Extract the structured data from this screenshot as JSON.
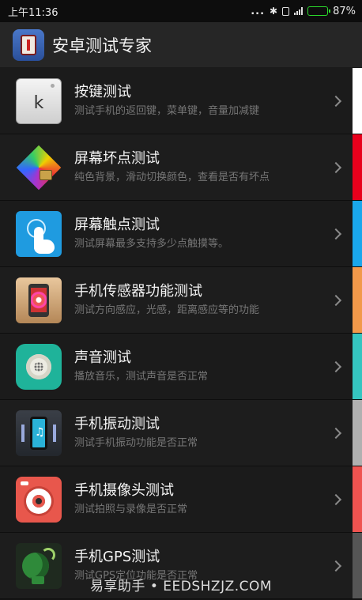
{
  "statusbar": {
    "time": "上午11:36",
    "dots": "...",
    "battery": "87%",
    "battery_level": 0.87
  },
  "header": {
    "title": "安卓测试专家"
  },
  "items": [
    {
      "title": "按键测试",
      "desc": "测试手机的返回键，菜单键，音量加减键",
      "icon": "keyboard-key-icon",
      "icon_letter": "k",
      "stripe": "#ffffff"
    },
    {
      "title": "屏幕坏点测试",
      "desc": "纯色背景，滑动切换颜色，查看是否有坏点",
      "icon": "dead-pixel-icon",
      "stripe": "#e8001c"
    },
    {
      "title": "屏幕触点测试",
      "desc": "测试屏幕最多支持多少点触摸等。",
      "icon": "touch-icon",
      "stripe": "#1aa7ec"
    },
    {
      "title": "手机传感器功能测试",
      "desc": "测试方向感应，光感，距离感应等的功能",
      "icon": "sensor-icon",
      "stripe": "#f2994a"
    },
    {
      "title": "声音测试",
      "desc": "播放音乐，测试声音是否正常",
      "icon": "speaker-icon",
      "stripe": "#35c5c0"
    },
    {
      "title": "手机振动测试",
      "desc": "测试手机振动功能是否正常",
      "icon": "vibration-icon",
      "stripe": "#b0b0b0"
    },
    {
      "title": "手机摄像头测试",
      "desc": "测试拍照与录像是否正常",
      "icon": "camera-icon",
      "stripe": "#ef5350"
    },
    {
      "title": "手机GPS测试",
      "desc": "测试GPS定位功能是否正常",
      "icon": "gps-dish-icon",
      "stripe": "#555555"
    }
  ],
  "watermark": "易享助手 • EEDSHZJZ.COM"
}
